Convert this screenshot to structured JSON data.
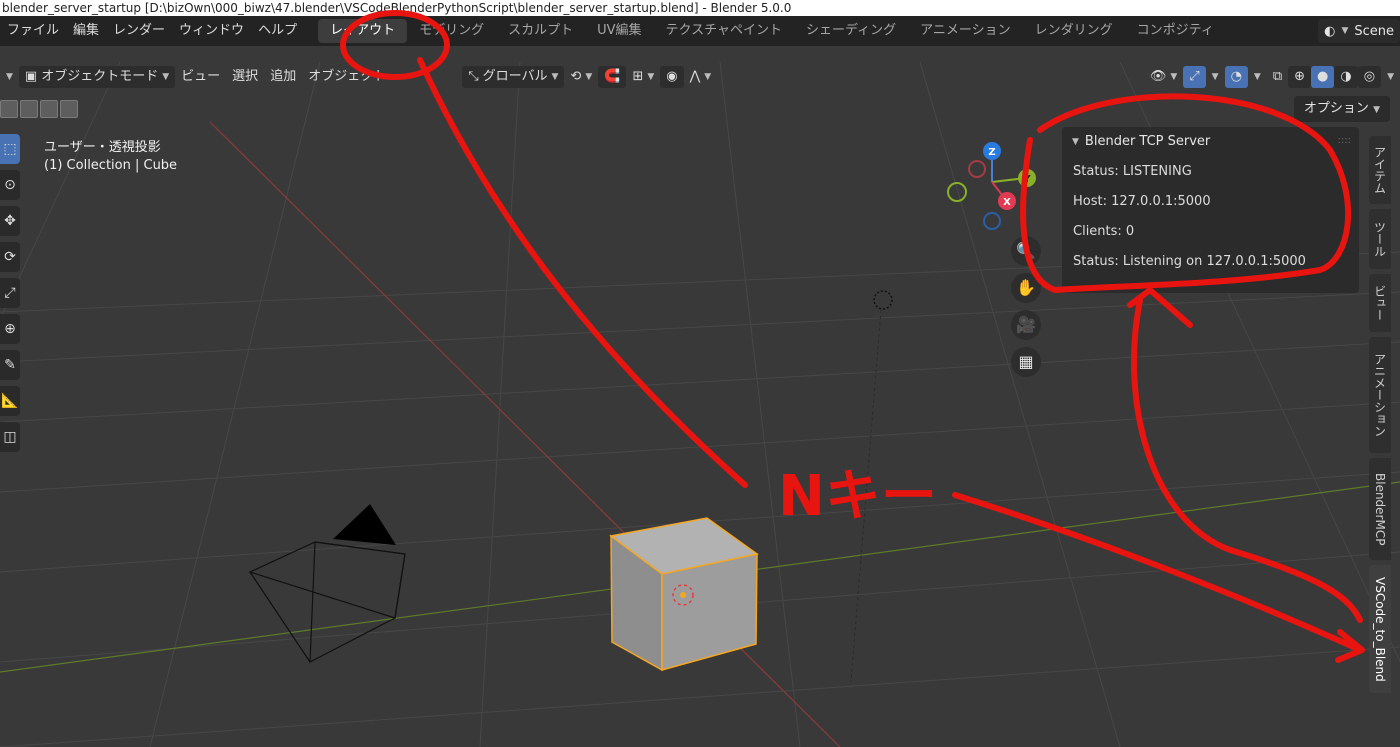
{
  "window": {
    "title": "blender_server_startup [D:\\bizOwn\\000_biwz\\47.blender\\VSCodeBlenderPythonScript\\blender_server_startup.blend] - Blender 5.0.0"
  },
  "menu": [
    "ファイル",
    "編集",
    "レンダー",
    "ウィンドウ",
    "ヘルプ"
  ],
  "workspaces": [
    "レイアウト",
    "モデリング",
    "スカルプト",
    "UV編集",
    "テクスチャペイント",
    "シェーディング",
    "アニメーション",
    "レンダリング",
    "コンポジティ"
  ],
  "scene": {
    "label": "Scene"
  },
  "header": {
    "mode": "オブジェクトモード",
    "view": "ビュー",
    "select": "選択",
    "add": "追加",
    "object": "オブジェクト",
    "transform": "グローバル"
  },
  "options_label": "オプション",
  "viewport": {
    "view_name": "ユーザー・透視投影",
    "collection_info": "(1) Collection | Cube"
  },
  "gizmo": {
    "z": "Z",
    "y": "Y",
    "x": "X"
  },
  "panel": {
    "title": "Blender TCP Server",
    "status": "Status: LISTENING",
    "host": "Host: 127.0.0.1:5000",
    "clients": "Clients: 0",
    "status_detail": "Status: Listening on 127.0.0.1:5000"
  },
  "side_tabs": [
    "アイテム",
    "ツール",
    "ビュー",
    "アニメーション",
    "BlenderMCP",
    "VSCode_to_Blend"
  ],
  "annotation": {
    "text": "Nキー"
  },
  "colors": {
    "accent": "#4872b3",
    "annotation": "#e8140f",
    "selection": "#f5a623"
  }
}
